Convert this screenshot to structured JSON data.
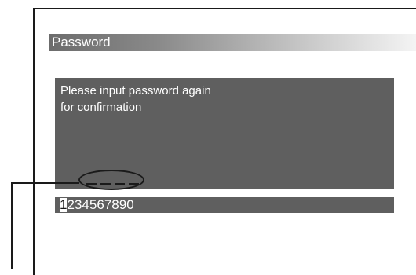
{
  "window": {
    "title": "Password"
  },
  "message": {
    "line1": "Please input password again",
    "line2": "for confirmation"
  },
  "entry": {
    "slot_count": 4
  },
  "keypad": {
    "selected_index": 0,
    "digits": [
      "1",
      "2",
      "3",
      "4",
      "5",
      "6",
      "7",
      "8",
      "9",
      "0"
    ]
  }
}
